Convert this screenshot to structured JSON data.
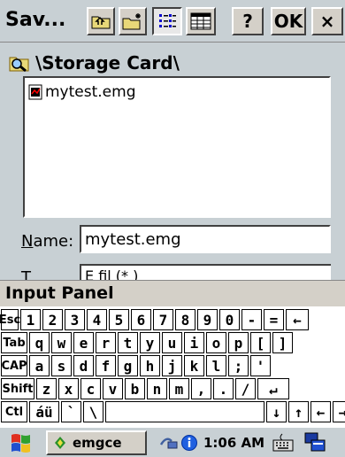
{
  "window": {
    "title": "Sav...",
    "buttons": {
      "help": "?",
      "ok": "OK",
      "close": "×"
    }
  },
  "location": {
    "path": "\\Storage Card\\"
  },
  "files": [
    {
      "name": "mytest.emg"
    }
  ],
  "form": {
    "name_label": "Name:",
    "name_label_mnemonic": "N",
    "name_label_rest": "ame:",
    "name_value": "mytest.emg",
    "type_label": "T",
    "type_value": "E   fil   (*   )"
  },
  "input_panel": {
    "title": "Input Panel",
    "rows": [
      [
        "Esc",
        "1",
        "2",
        "3",
        "4",
        "5",
        "6",
        "7",
        "8",
        "9",
        "0",
        "-",
        "=",
        "←"
      ],
      [
        "Tab",
        "q",
        "w",
        "e",
        "r",
        "t",
        "y",
        "u",
        "i",
        "o",
        "p",
        "[",
        "]"
      ],
      [
        "CAP",
        "a",
        "s",
        "d",
        "f",
        "g",
        "h",
        "j",
        "k",
        "l",
        ";",
        "'"
      ],
      [
        "Shift",
        "z",
        "x",
        "c",
        "v",
        "b",
        "n",
        "m",
        ",",
        ".",
        "/",
        "↵"
      ],
      [
        "Ctl",
        "áü",
        "`",
        "\\",
        "",
        "↓",
        "↑",
        "←",
        "→"
      ]
    ]
  },
  "taskbar": {
    "task_label": "emgce",
    "clock": "1:06 AM"
  }
}
